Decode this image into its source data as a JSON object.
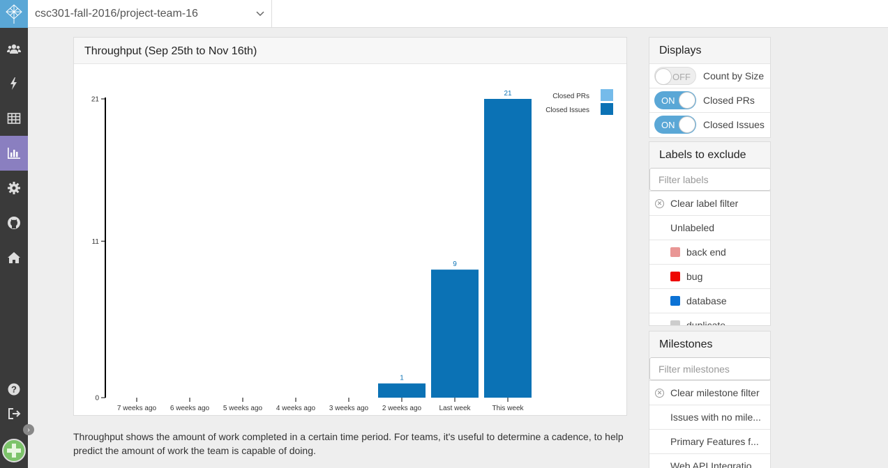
{
  "topbar": {
    "repo": "csc301-fall-2016/project-team-16"
  },
  "sidebar": {
    "items": [
      {
        "name": "team-icon"
      },
      {
        "name": "lightning-icon"
      },
      {
        "name": "table-icon"
      },
      {
        "name": "bar-chart-icon",
        "active": true
      },
      {
        "name": "gear-icon"
      },
      {
        "name": "github-icon"
      },
      {
        "name": "home-icon"
      },
      {
        "name": "help-icon"
      },
      {
        "name": "signout-icon"
      }
    ]
  },
  "chart": {
    "title": "Throughput (Sep 25th to Nov 16th)"
  },
  "chart_data": {
    "type": "bar",
    "title": "Throughput (Sep 25th to Nov 16th)",
    "categories": [
      "7 weeks ago",
      "6 weeks ago",
      "5 weeks ago",
      "4 weeks ago",
      "3 weeks ago",
      "2 weeks ago",
      "Last week",
      "This week"
    ],
    "series": [
      {
        "name": "Closed PRs",
        "color": "#75bbea",
        "values": [
          0,
          0,
          0,
          0,
          0,
          0,
          0,
          0
        ]
      },
      {
        "name": "Closed Issues",
        "color": "#0b72b5",
        "values": [
          0,
          0,
          0,
          0,
          0,
          1,
          9,
          21
        ]
      }
    ],
    "totals": [
      null,
      null,
      null,
      null,
      null,
      1,
      9,
      21
    ],
    "yticks": [
      0,
      11,
      21
    ],
    "ylim": [
      0,
      21
    ],
    "legend": "top-right"
  },
  "description": "Throughput shows the amount of work completed in a certain time period. For teams, it's useful to determine a cadence, to help predict the amount of work the team is capable of doing.",
  "displays": {
    "title": "Displays",
    "toggles": [
      {
        "state": "OFF",
        "label": "Count by Size"
      },
      {
        "state": "ON",
        "label": "Closed PRs"
      },
      {
        "state": "ON",
        "label": "Closed Issues"
      }
    ]
  },
  "labels": {
    "title": "Labels to exclude",
    "placeholder": "Filter labels",
    "clear": "Clear label filter",
    "items": [
      {
        "label": "Unlabeled",
        "color": ""
      },
      {
        "label": "back end",
        "color": "#e99695"
      },
      {
        "label": "bug",
        "color": "#ee0701"
      },
      {
        "label": "database",
        "color": "#0b72d5"
      },
      {
        "label": "duplicate",
        "color": "#cccccc"
      }
    ]
  },
  "milestones": {
    "title": "Milestones",
    "placeholder": "Filter milestones",
    "clear": "Clear milestone filter",
    "items": [
      "Issues with no mile...",
      "Primary Features f...",
      "Web API Integratio..."
    ]
  }
}
